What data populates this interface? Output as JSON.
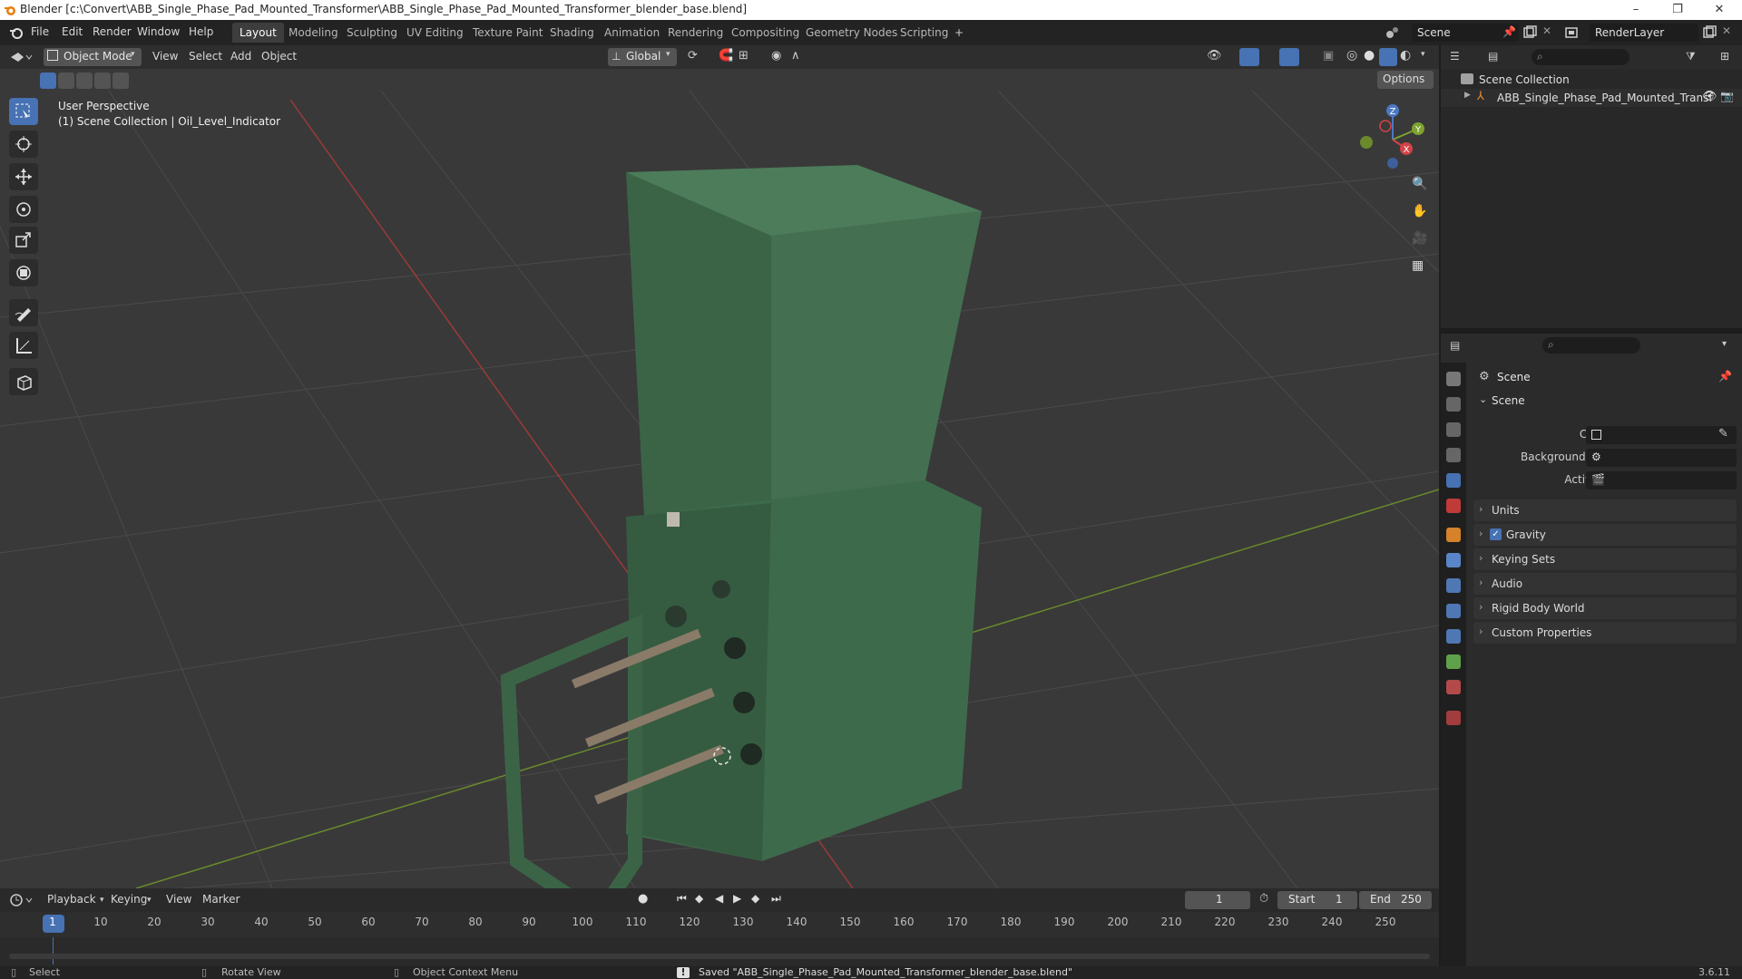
{
  "window": {
    "title": "Blender [c:\\Convert\\ABB_Single_Phase_Pad_Mounted_Transformer\\ABB_Single_Phase_Pad_Mounted_Transformer_blender_base.blend]",
    "minimize": "–",
    "maximize": "❐",
    "close": "✕"
  },
  "menu": {
    "items": [
      "File",
      "Edit",
      "Render",
      "Window",
      "Help"
    ]
  },
  "workspaces": [
    "Layout",
    "Modeling",
    "Sculpting",
    "UV Editing",
    "Texture Paint",
    "Shading",
    "Animation",
    "Rendering",
    "Compositing",
    "Geometry Nodes",
    "Scripting",
    "+"
  ],
  "active_workspace": "Layout",
  "scene_selector": {
    "value": "Scene"
  },
  "view_layer_selector": {
    "value": "RenderLayer"
  },
  "viewport": {
    "mode": "Object Mode",
    "menus": [
      "View",
      "Select",
      "Add",
      "Object"
    ],
    "transform_orientation": "Global",
    "options_label": "Options",
    "overlay_title": "User Perspective",
    "overlay_subtitle": "(1) Scene Collection | Oil_Level_Indicator",
    "gizmo_axes": {
      "x": "X",
      "y": "Y",
      "z": "Z"
    },
    "colors": {
      "background": "#393939",
      "grid_x": "#9b3a3a",
      "grid_y": "#6a8a2c",
      "model_green": "#3f6b4d"
    }
  },
  "tools": [
    "select-box",
    "cursor",
    "move",
    "rotate",
    "scale",
    "transform",
    "annotate",
    "measure",
    "add-cube"
  ],
  "outliner": {
    "root": "Scene Collection",
    "items": [
      {
        "label": "ABB_Single_Phase_Pad_Mounted_Transf"
      }
    ]
  },
  "properties": {
    "header": "Scene",
    "panel": "Scene",
    "fields": [
      {
        "label": "Camera"
      },
      {
        "label": "Background Scene"
      },
      {
        "label": "Active Clip"
      }
    ],
    "subpanels": [
      "Units",
      "Gravity",
      "Keying Sets",
      "Audio",
      "Rigid Body World",
      "Custom Properties"
    ],
    "gravity_checked": true
  },
  "timeline": {
    "menus": [
      "Playback",
      "Keying",
      "View",
      "Marker"
    ],
    "current_frame": "1",
    "start_label": "Start",
    "start": "1",
    "end_label": "End",
    "end": "250",
    "ticks": [
      "1",
      "10",
      "20",
      "30",
      "40",
      "50",
      "60",
      "70",
      "80",
      "90",
      "100",
      "110",
      "120",
      "130",
      "140",
      "150",
      "160",
      "170",
      "180",
      "190",
      "200",
      "210",
      "220",
      "230",
      "240",
      "250"
    ]
  },
  "status": {
    "select": "Select",
    "rotate": "Rotate View",
    "context_menu": "Object Context Menu",
    "message": "Saved \"ABB_Single_Phase_Pad_Mounted_Transformer_blender_base.blend\"",
    "version": "3.6.11"
  }
}
